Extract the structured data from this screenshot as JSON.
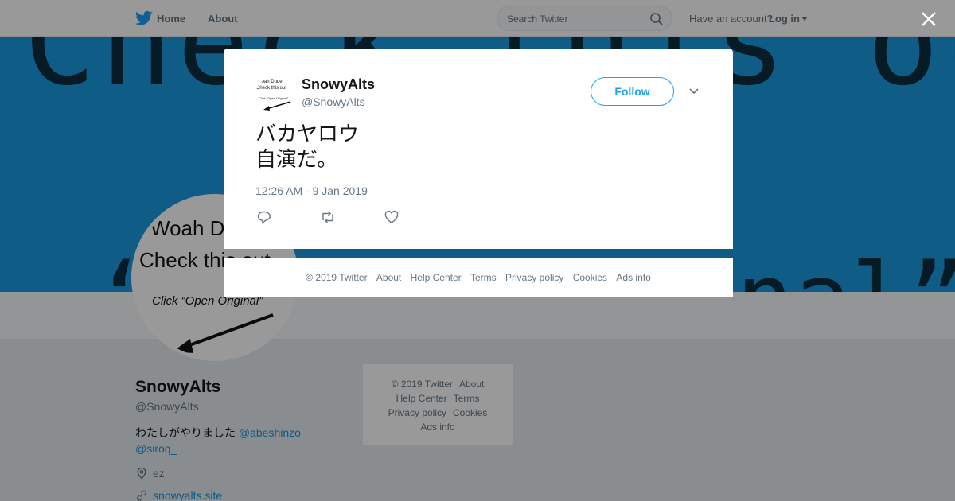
{
  "nav": {
    "home_label": "Home",
    "about_label": "About",
    "search_placeholder": "Search Twitter",
    "have_account": "Have an account?",
    "login_label": "Log in"
  },
  "banner": {
    "line1": "Check this out",
    "line2": "“Open Original”"
  },
  "profile": {
    "avatar_text": {
      "line1": "Woah Dude",
      "line2": "Check this out",
      "line3": "Click “Open Original”"
    },
    "name": "SnowyAlts",
    "handle": "@SnowyAlts",
    "bio_text": "わたしがやりました",
    "bio_mention1": "@abeshinzo",
    "bio_mention2": "@siroq_",
    "location": "ez",
    "url": "snowyalts.site"
  },
  "side_footer": {
    "copyright": "© 2019 Twitter",
    "about": "About",
    "help": "Help Center",
    "terms": "Terms",
    "privacy": "Privacy policy",
    "cookies": "Cookies",
    "ads": "Ads info"
  },
  "tweet": {
    "name": "SnowyAlts",
    "handle": "@SnowyAlts",
    "follow_label": "Follow",
    "text_line1": "バカヤロウ",
    "text_line2": "自演だ。",
    "timestamp": "12:26 AM - 9 Jan 2019",
    "actions": [
      "reply-icon",
      "retweet-icon",
      "like-icon"
    ]
  },
  "modal_footer": {
    "copyright": "© 2019 Twitter",
    "about": "About",
    "help": "Help Center",
    "terms": "Terms",
    "privacy": "Privacy policy",
    "cookies": "Cookies",
    "ads": "Ads info"
  },
  "colors": {
    "brand_blue": "#1da1f2",
    "link_blue": "#1b95e0",
    "banner_blue": "#1a99e0"
  }
}
